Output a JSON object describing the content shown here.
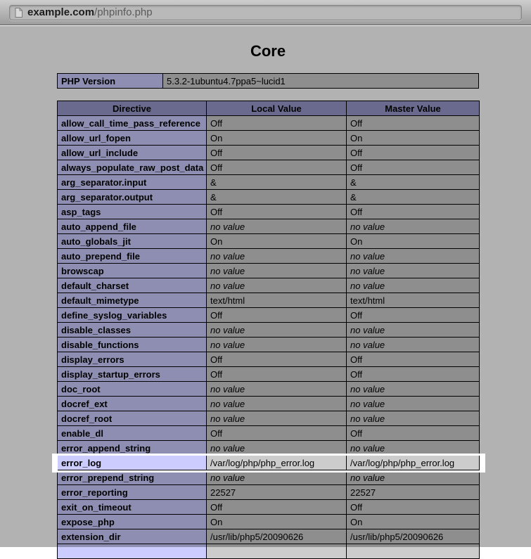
{
  "browser": {
    "url_host": "example.com",
    "url_path": "/phpinfo.php"
  },
  "page": {
    "title": "Core",
    "version_label": "PHP Version",
    "version_value": "5.3.2-1ubuntu4.7ppa5~lucid1"
  },
  "table": {
    "headers": [
      "Directive",
      "Local Value",
      "Master Value"
    ],
    "no_value_text": "no value",
    "rows": [
      {
        "directive": "allow_call_time_pass_reference",
        "local": "Off",
        "master": "Off"
      },
      {
        "directive": "allow_url_fopen",
        "local": "On",
        "master": "On"
      },
      {
        "directive": "allow_url_include",
        "local": "Off",
        "master": "Off"
      },
      {
        "directive": "always_populate_raw_post_data",
        "local": "Off",
        "master": "Off"
      },
      {
        "directive": "arg_separator.input",
        "local": "&",
        "master": "&"
      },
      {
        "directive": "arg_separator.output",
        "local": "&",
        "master": "&"
      },
      {
        "directive": "asp_tags",
        "local": "Off",
        "master": "Off"
      },
      {
        "directive": "auto_append_file",
        "local": "no value",
        "master": "no value"
      },
      {
        "directive": "auto_globals_jit",
        "local": "On",
        "master": "On"
      },
      {
        "directive": "auto_prepend_file",
        "local": "no value",
        "master": "no value"
      },
      {
        "directive": "browscap",
        "local": "no value",
        "master": "no value"
      },
      {
        "directive": "default_charset",
        "local": "no value",
        "master": "no value"
      },
      {
        "directive": "default_mimetype",
        "local": "text/html",
        "master": "text/html"
      },
      {
        "directive": "define_syslog_variables",
        "local": "Off",
        "master": "Off"
      },
      {
        "directive": "disable_classes",
        "local": "no value",
        "master": "no value"
      },
      {
        "directive": "disable_functions",
        "local": "no value",
        "master": "no value"
      },
      {
        "directive": "display_errors",
        "local": "Off",
        "master": "Off"
      },
      {
        "directive": "display_startup_errors",
        "local": "Off",
        "master": "Off"
      },
      {
        "directive": "doc_root",
        "local": "no value",
        "master": "no value"
      },
      {
        "directive": "docref_ext",
        "local": "no value",
        "master": "no value"
      },
      {
        "directive": "docref_root",
        "local": "no value",
        "master": "no value"
      },
      {
        "directive": "enable_dl",
        "local": "Off",
        "master": "Off"
      },
      {
        "directive": "error_append_string",
        "local": "no value",
        "master": "no value"
      },
      {
        "directive": "error_log",
        "local": "/var/log/php/php_error.log",
        "master": "/var/log/php/php_error.log",
        "highlighted": true
      },
      {
        "directive": "error_prepend_string",
        "local": "no value",
        "master": "no value"
      },
      {
        "directive": "error_reporting",
        "local": "22527",
        "master": "22527"
      },
      {
        "directive": "exit_on_timeout",
        "local": "Off",
        "master": "Off"
      },
      {
        "directive": "expose_php",
        "local": "On",
        "master": "On"
      },
      {
        "directive": "extension_dir",
        "local": "/usr/lib/php5/20090626",
        "master": "/usr/lib/php5/20090626"
      },
      {
        "directive": "",
        "local": "",
        "master": ""
      }
    ]
  },
  "colors": {
    "header_bg": "#9999cc",
    "directive_bg": "#ccccff",
    "value_bg": "#cccccc",
    "highlight_outline": "#ffffff",
    "dim_overlay": "rgba(0,0,0,0.30)",
    "page_bg": "#ffffff"
  }
}
